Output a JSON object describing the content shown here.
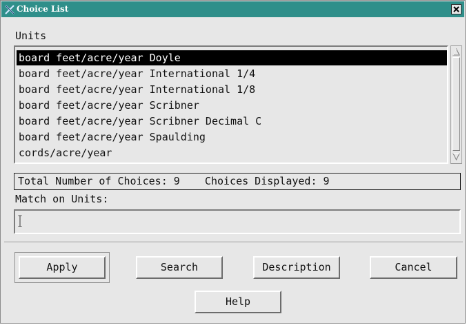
{
  "window": {
    "title": "Choice List",
    "icon": "x-window-icon",
    "close_icon": "close-icon"
  },
  "colors": {
    "titlebar": "#2f8f8a",
    "background": "#e7e7e7",
    "selection": "#000000"
  },
  "list": {
    "label": "Units",
    "items": [
      "board feet/acre/year Doyle",
      "board feet/acre/year International 1/4",
      "board feet/acre/year International 1/8",
      "board feet/acre/year Scribner",
      "board feet/acre/year Scribner Decimal C",
      "board feet/acre/year Spaulding",
      "cords/acre/year"
    ],
    "selected_index": 0
  },
  "status": {
    "text": "Total Number of Choices: 9    Choices Displayed: 9"
  },
  "match": {
    "label": "Match on Units:",
    "value": "",
    "placeholder": ""
  },
  "buttons": {
    "apply": "Apply",
    "search": "Search",
    "description": "Description",
    "cancel": "Cancel",
    "help": "Help"
  }
}
